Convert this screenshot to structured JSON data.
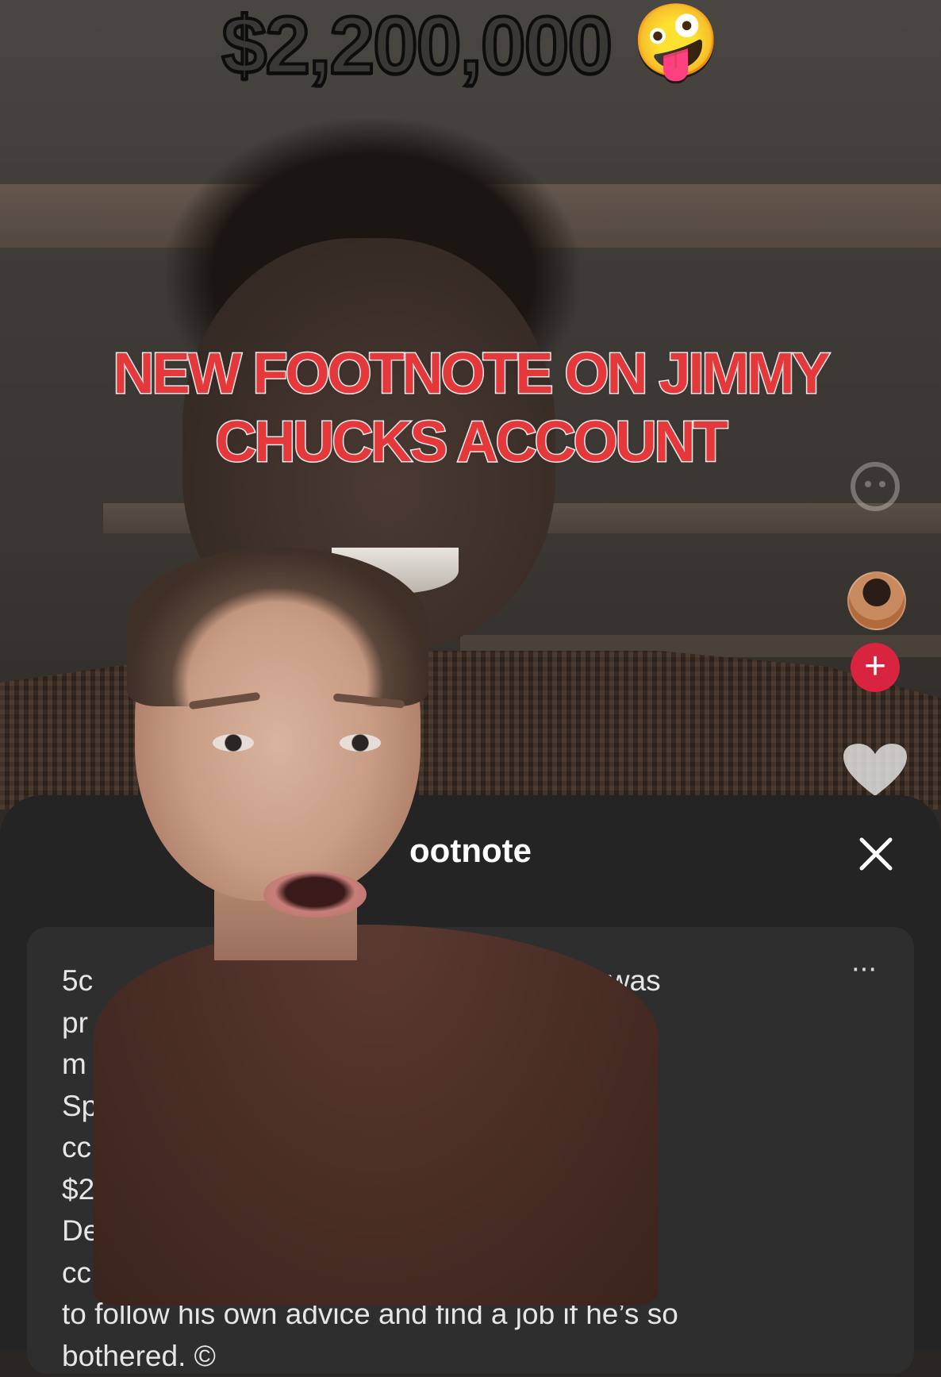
{
  "overlay": {
    "top_caption": "$2,200,000",
    "top_caption_emoji": "🤪",
    "headline": "NEW FOOTNOTE ON JIMMY CHUCKS ACCOUNT"
  },
  "side_actions": {
    "avatar_icon": "creator-avatar",
    "follow_icon": "plus-icon",
    "follow_label": "+",
    "like_icon": "heart-icon",
    "emoji_icon": "smiley-icon"
  },
  "footnote_panel": {
    "title": "ootnote",
    "close_label": "×",
    "more_label": "···",
    "text_lines": [
      "5c                                      own creep who was",
      "pr                                       opriate",
      "m                                        ied a former",
      "Sp                                       af rant, is",
      "cc                                       wing him",
      "$2                                       lette.",
      "De                                       hem in the",
      "cc                                       es Charles",
      "to follow his own advice and find a job if he’s so",
      "bothered. ©"
    ]
  },
  "colors": {
    "headline": "#e5383b",
    "panel": "#242424",
    "card": "#2e2e2e",
    "follow": "#d9243f"
  }
}
